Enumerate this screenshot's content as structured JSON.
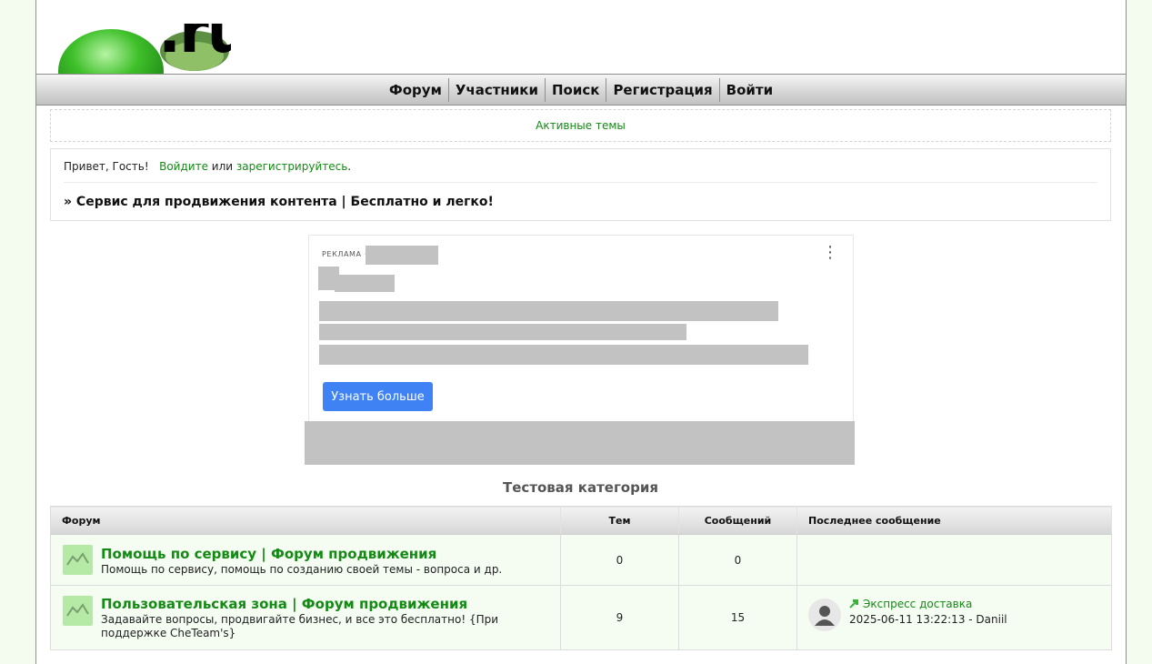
{
  "logo": {
    "text": ".ru"
  },
  "nav": {
    "items": [
      "Форум",
      "Участники",
      "Поиск",
      "Регистрация",
      "Войти"
    ]
  },
  "active_topics": "Активные темы",
  "greeting": {
    "hello": "Привет, Гость!",
    "login": "Войдите",
    "or": "или",
    "register": "зарегистрируйтесь",
    "dot": "."
  },
  "promo": "» Сервис для продвижения контента | Бесплатно и легко!",
  "ad": {
    "label": "РЕКЛАМА ·",
    "button": "Узнать больше"
  },
  "category": {
    "title": "Тестовая категория",
    "headers": {
      "forum": "Форум",
      "topics": "Тем",
      "posts": "Сообщений",
      "last": "Последнее сообщение"
    },
    "forums": [
      {
        "name": "Помощь по сервису | Форум продвижения",
        "desc": "Помощь по сервису, помощь по созданию своей темы - вопроса и др.",
        "topics": "0",
        "posts": "0"
      },
      {
        "name": "Пользовательская зона | Форум продвижения",
        "desc": "Задавайте вопросы, продвигайте бизнес, и все это бесплатно! {При поддержке CheTeam's}",
        "topics": "9",
        "posts": "15",
        "last_title": "Экспресс доставка",
        "last_meta": "2025-06-11 13:22:13 - Daniil"
      }
    ]
  },
  "colors": {
    "link": "#148a14",
    "button": "#3f82f4",
    "icon_bg": "#b5e9a6"
  },
  "icons": [
    "forum-icon",
    "avatar-icon",
    "arrow-icon",
    "more-icon"
  ]
}
